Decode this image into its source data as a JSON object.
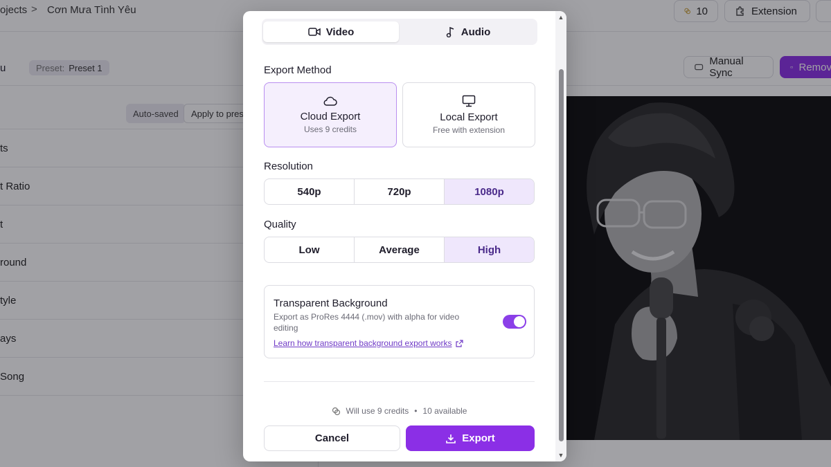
{
  "background": {
    "breadcrumb": {
      "parent": "ojects",
      "separator": ">",
      "current": "Cơn Mưa Tình Yêu"
    },
    "credits_count": "10",
    "extension_label": "Extension",
    "row2": {
      "left_text": "u",
      "preset_label": "Preset:",
      "preset_value": "Preset 1",
      "manual_sync": "Manual Sync",
      "remove": "Remov"
    },
    "autosaved": "Auto-saved",
    "apply_to_preset": "Apply to pres",
    "sidebar_items": [
      "ts",
      "t Ratio",
      "t",
      "round",
      "tyle",
      "ays",
      "Song"
    ]
  },
  "modal": {
    "tabs": [
      {
        "label": "Video",
        "icon": "video-camera-icon",
        "active": true
      },
      {
        "label": "Audio",
        "icon": "music-note-icon",
        "active": false
      }
    ],
    "export_method": {
      "label": "Export Method",
      "options": [
        {
          "title": "Cloud Export",
          "subtitle": "Uses 9 credits",
          "icon": "cloud-icon",
          "active": true
        },
        {
          "title": "Local Export",
          "subtitle": "Free with extension",
          "icon": "monitor-icon",
          "active": false
        }
      ]
    },
    "resolution": {
      "label": "Resolution",
      "options": [
        "540p",
        "720p",
        "1080p"
      ],
      "selected": "1080p"
    },
    "quality": {
      "label": "Quality",
      "options": [
        "Low",
        "Average",
        "High"
      ],
      "selected": "High"
    },
    "transparent_background": {
      "title": "Transparent Background",
      "description": "Export as ProRes 4444 (.mov) with alpha for video editing",
      "link": "Learn how transparent background export works",
      "enabled": true
    },
    "credits_info": {
      "uses": "Will use 9 credits",
      "separator": "•",
      "available": "10 available"
    },
    "cancel_label": "Cancel",
    "export_label": "Export"
  },
  "colors": {
    "accent": "#8b2fe6",
    "accent_light": "#f5effd"
  }
}
